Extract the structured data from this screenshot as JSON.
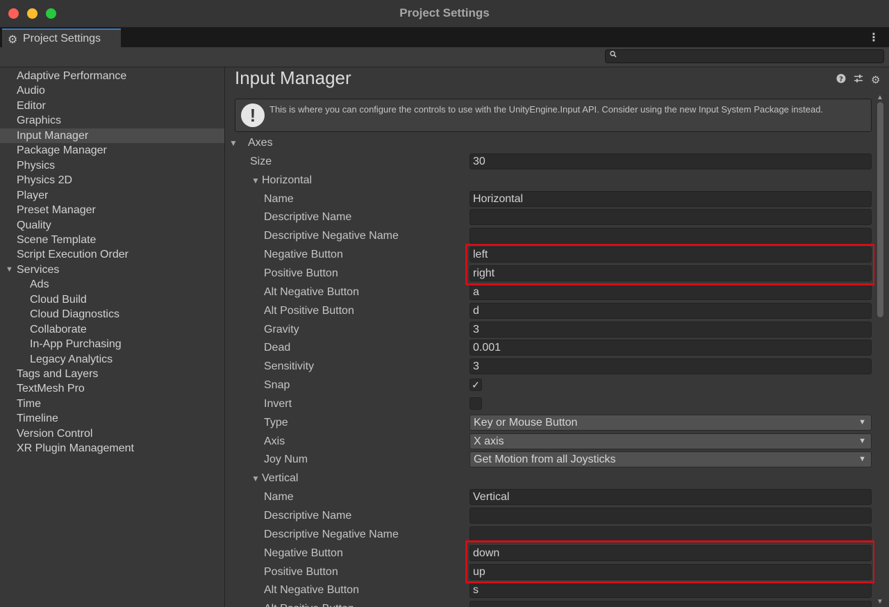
{
  "window": {
    "title": "Project Settings"
  },
  "tab": {
    "label": "Project Settings",
    "icon": "gear-icon"
  },
  "search": {
    "placeholder": "",
    "value": ""
  },
  "sidebar": {
    "items": [
      {
        "label": "Adaptive Performance"
      },
      {
        "label": "Audio"
      },
      {
        "label": "Editor"
      },
      {
        "label": "Graphics"
      },
      {
        "label": "Input Manager",
        "selected": true
      },
      {
        "label": "Package Manager"
      },
      {
        "label": "Physics"
      },
      {
        "label": "Physics 2D"
      },
      {
        "label": "Player"
      },
      {
        "label": "Preset Manager"
      },
      {
        "label": "Quality"
      },
      {
        "label": "Scene Template"
      },
      {
        "label": "Script Execution Order"
      },
      {
        "label": "Services",
        "expanded": true
      },
      {
        "label": "Ads",
        "child": true
      },
      {
        "label": "Cloud Build",
        "child": true
      },
      {
        "label": "Cloud Diagnostics",
        "child": true
      },
      {
        "label": "Collaborate",
        "child": true
      },
      {
        "label": "In-App Purchasing",
        "child": true
      },
      {
        "label": "Legacy Analytics",
        "child": true
      },
      {
        "label": "Tags and Layers"
      },
      {
        "label": "TextMesh Pro"
      },
      {
        "label": "Time"
      },
      {
        "label": "Timeline"
      },
      {
        "label": "Version Control"
      },
      {
        "label": "XR Plugin Management"
      }
    ]
  },
  "main": {
    "title": "Input Manager",
    "header_icons": [
      "help-icon",
      "sliders-icon",
      "gear-icon"
    ],
    "info": "This is where you can configure the controls to use with the UnityEngine.Input API. Consider using the new Input System Package instead.",
    "axes_label": "Axes",
    "size_label": "Size",
    "size_value": "30",
    "horizontal": {
      "header": "Horizontal",
      "fields": [
        {
          "label": "Name",
          "value": "Horizontal",
          "kind": "text"
        },
        {
          "label": "Descriptive Name",
          "value": "",
          "kind": "text"
        },
        {
          "label": "Descriptive Negative Name",
          "value": "",
          "kind": "text"
        },
        {
          "label": "Negative Button",
          "value": "left",
          "kind": "text"
        },
        {
          "label": "Positive Button",
          "value": "right",
          "kind": "text"
        },
        {
          "label": "Alt Negative Button",
          "value": "a",
          "kind": "text"
        },
        {
          "label": "Alt Positive Button",
          "value": "d",
          "kind": "text"
        },
        {
          "label": "Gravity",
          "value": "3",
          "kind": "text"
        },
        {
          "label": "Dead",
          "value": "0.001",
          "kind": "text"
        },
        {
          "label": "Sensitivity",
          "value": "3",
          "kind": "text"
        },
        {
          "label": "Snap",
          "checked": true,
          "kind": "check"
        },
        {
          "label": "Invert",
          "checked": false,
          "kind": "check"
        },
        {
          "label": "Type",
          "value": "Key or Mouse Button",
          "kind": "select"
        },
        {
          "label": "Axis",
          "value": "X axis",
          "kind": "select"
        },
        {
          "label": "Joy Num",
          "value": "Get Motion from all Joysticks",
          "kind": "select"
        }
      ]
    },
    "vertical": {
      "header": "Vertical",
      "fields": [
        {
          "label": "Name",
          "value": "Vertical",
          "kind": "text"
        },
        {
          "label": "Descriptive Name",
          "value": "",
          "kind": "text"
        },
        {
          "label": "Descriptive Negative Name",
          "value": "",
          "kind": "text"
        },
        {
          "label": "Negative Button",
          "value": "down",
          "kind": "text"
        },
        {
          "label": "Positive Button",
          "value": "up",
          "kind": "text"
        },
        {
          "label": "Alt Negative Button",
          "value": "s",
          "kind": "text"
        },
        {
          "label": "Alt Positive Button",
          "value": "",
          "kind": "text"
        }
      ]
    }
  },
  "colors": {
    "highlight": "#d40e16",
    "accent": "#3a79bb"
  }
}
